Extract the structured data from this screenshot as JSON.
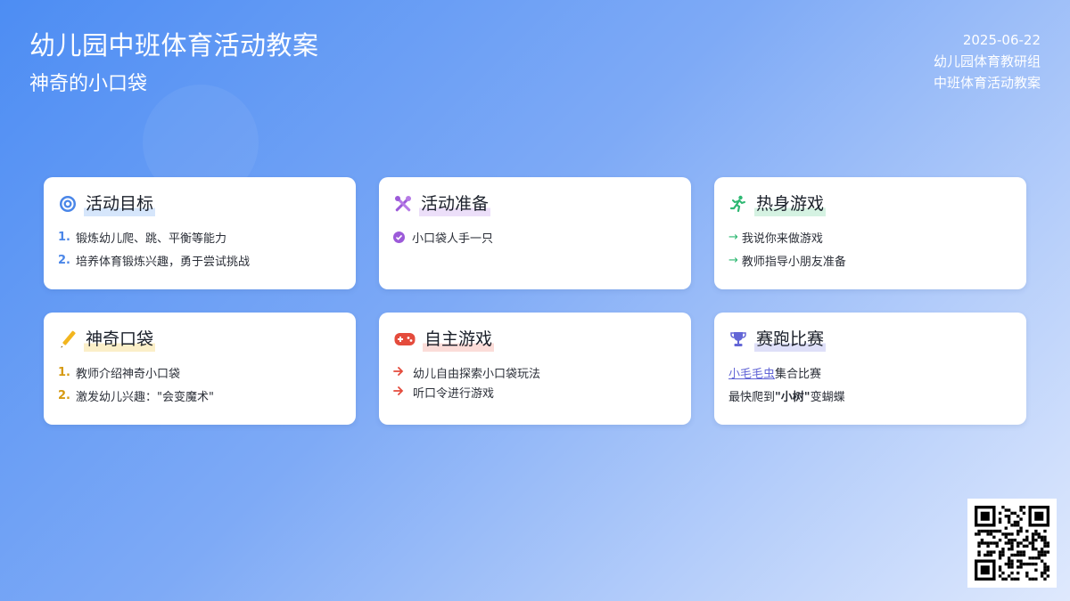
{
  "header": {
    "title": "幼儿园中班体育活动教案",
    "subtitle": "神奇的小口袋"
  },
  "meta": {
    "date": "2025-06-22",
    "group": "幼儿园体育教研组",
    "category": "中班体育活动教案"
  },
  "colors": {
    "goal": "#4a86e8",
    "prep": "#9c5ad9",
    "warmup": "#2eb872",
    "magic": "#e0a21a",
    "game": "#e44b3c",
    "race": "#6366d6"
  },
  "cards": {
    "goal": {
      "title": "活动目标",
      "icon": "target-icon",
      "items": [
        {
          "num": "1.",
          "text": "锻炼幼儿爬、跳、平衡等能力"
        },
        {
          "num": "2.",
          "text": "培养体育锻炼兴趣，勇于尝试挑战"
        }
      ]
    },
    "prep": {
      "title": "活动准备",
      "icon": "tools-icon",
      "items": [
        {
          "text": "小口袋人手一只"
        }
      ]
    },
    "warmup": {
      "title": "热身游戏",
      "icon": "running-icon",
      "items": [
        {
          "arrow": "→",
          "text": "我说你来做游戏"
        },
        {
          "arrow": "→",
          "text": "教师指导小朋友准备"
        }
      ]
    },
    "magic": {
      "title": "神奇口袋",
      "icon": "pencil-icon",
      "items": [
        {
          "num": "1.",
          "text": "教师介绍神奇小口袋"
        },
        {
          "num": "2.",
          "text": "激发幼儿兴趣：\"会变魔术\""
        }
      ]
    },
    "game": {
      "title": "自主游戏",
      "icon": "gamepad-icon",
      "items": [
        {
          "text": "幼儿自由探索小口袋玩法"
        },
        {
          "text": "听口令进行游戏"
        }
      ]
    },
    "race": {
      "title": "赛跑比赛",
      "icon": "trophy-icon",
      "line1_link": "小毛毛虫",
      "line1_rest": "集合比赛",
      "line2_pre": "最快爬到",
      "line2_bold": "\"小树\"",
      "line2_post": "变蝴蝶"
    }
  },
  "qr": {
    "icon": "qr-code-icon"
  }
}
